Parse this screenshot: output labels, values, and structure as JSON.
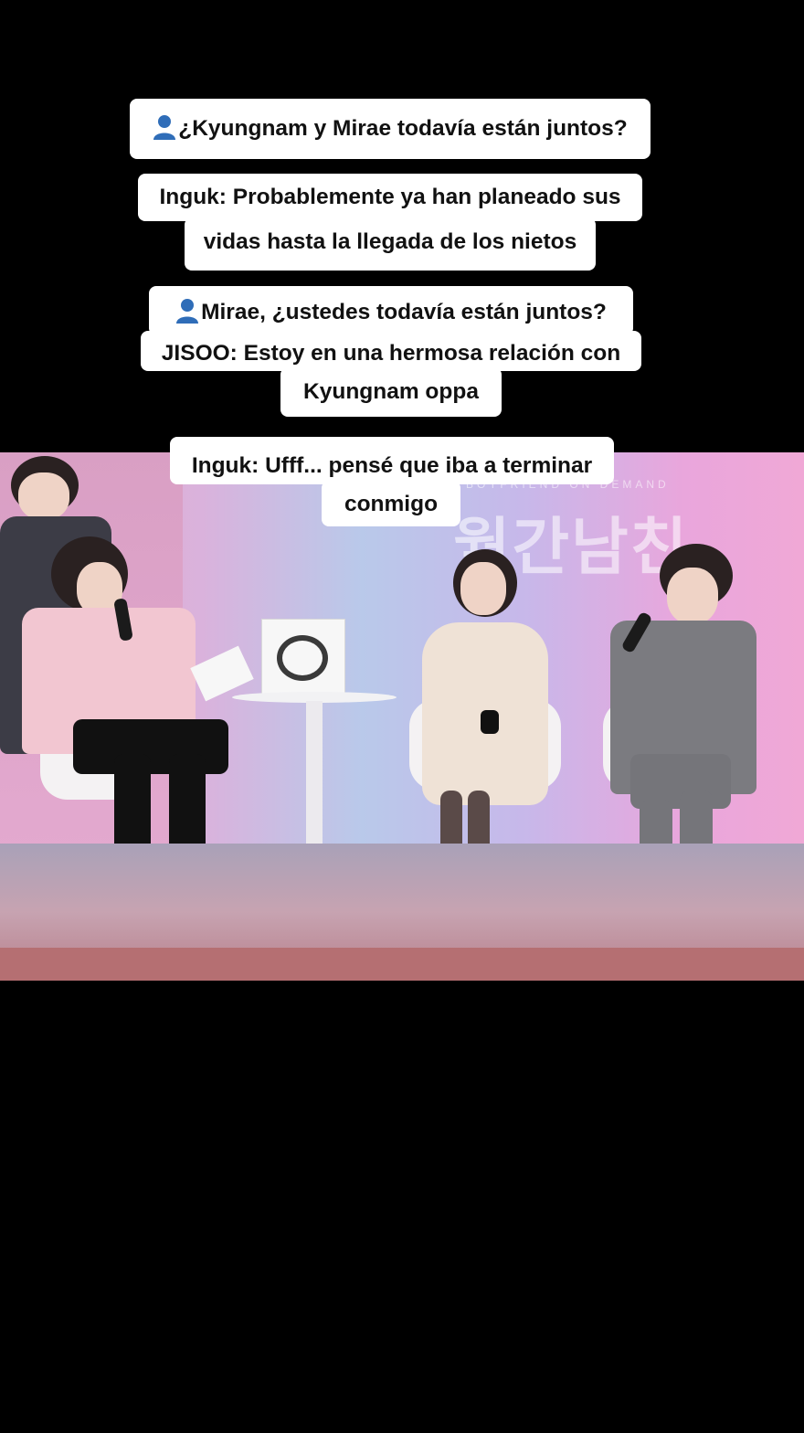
{
  "captions": {
    "c1": {
      "icon": "user-silhouette-icon",
      "text": "¿Kyungnam y Mirae todavía están juntos?"
    },
    "c2": {
      "line1": "Inguk: Probablemente ya han planeado sus",
      "line2": "vidas hasta la llegada de los nietos"
    },
    "c3": {
      "icon": "user-silhouette-icon",
      "line1": "Mirae, ¿ustedes todavía están juntos?",
      "line2": "JISOO: Estoy en una hermosa relación con",
      "line3": "Kyungnam oppa"
    },
    "c4": {
      "line1": "Inguk: Ufff... pensé que iba a terminar",
      "line2": "conmigo"
    }
  },
  "video": {
    "logo_text": "월간남친",
    "logo_sub": "BOYFRIEND ON DEMAND"
  },
  "colors": {
    "caption_bg": "#ffffff",
    "caption_text": "#111111",
    "page_bg": "#000000",
    "user_icon": "#2f6db8"
  }
}
